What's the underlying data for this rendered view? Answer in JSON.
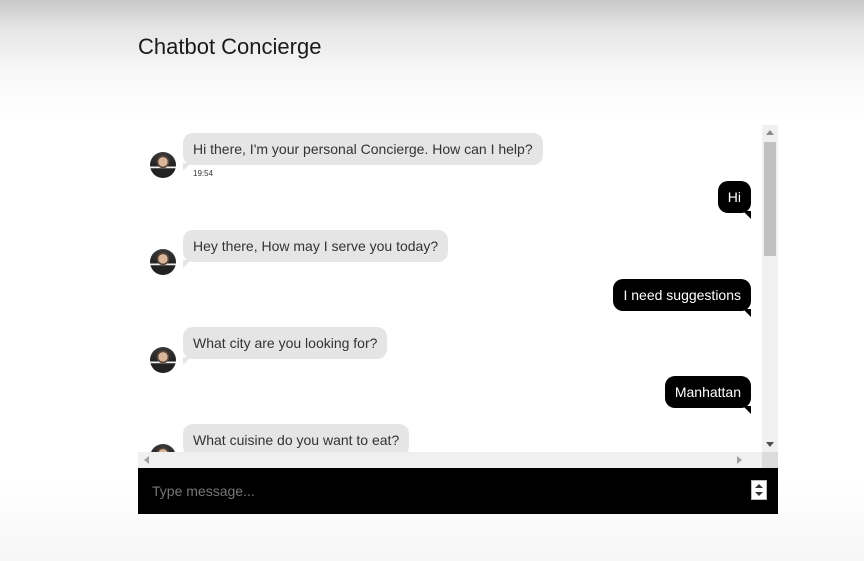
{
  "app": {
    "title": "Chatbot Concierge"
  },
  "messages": [
    {
      "sender": "bot",
      "text": "Hi there, I'm your personal Concierge. How can I help?",
      "time": "19:54"
    },
    {
      "sender": "user",
      "text": "Hi"
    },
    {
      "sender": "bot",
      "text": "Hey there, How may I serve you today?"
    },
    {
      "sender": "user",
      "text": "I need suggestions"
    },
    {
      "sender": "bot",
      "text": "What city are you looking for?"
    },
    {
      "sender": "user",
      "text": "Manhattan"
    },
    {
      "sender": "bot",
      "text": "What cuisine do you want to eat?"
    }
  ],
  "composer": {
    "placeholder": "Type message..."
  },
  "colors": {
    "user_bubble": "#000000",
    "bot_bubble": "#e5e5e5",
    "input_bar": "#000000"
  }
}
